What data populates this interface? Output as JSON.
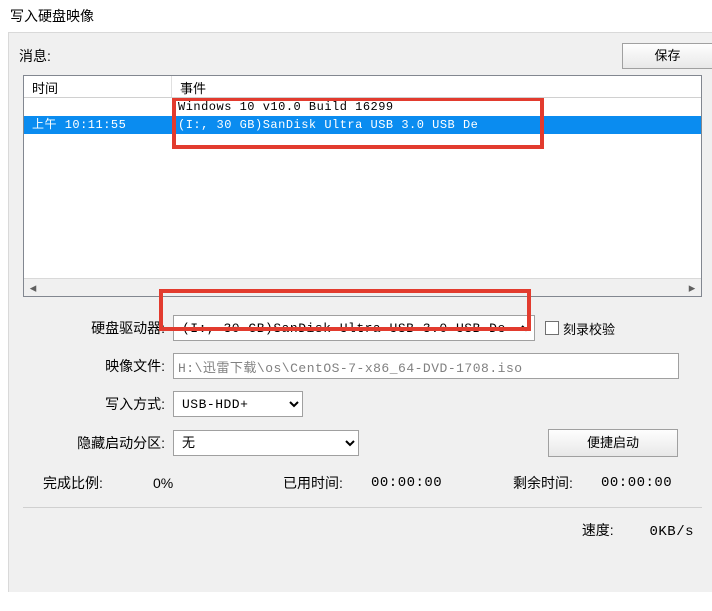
{
  "title": "写入硬盘映像",
  "msgLabel": "消息:",
  "saveLabel": "保存",
  "columns": {
    "time": "时间",
    "event": "事件"
  },
  "rows": [
    {
      "time": "",
      "event": "Windows 10 v10.0 Build 16299"
    },
    {
      "time": "上午 10:11:55",
      "event": "(I:, 30 GB)SanDisk Ultra USB 3.0 USB De"
    }
  ],
  "form": {
    "driveLabel": "硬盘驱动器:",
    "driveValue": "(I:, 30 GB)SanDisk Ultra USB 3.0 USB De",
    "verifyLabel": "刻录校验",
    "imageLabel": "映像文件:",
    "imageValue": "H:\\迅雷下载\\os\\CentOS-7-x86_64-DVD-1708.iso",
    "methodLabel": "写入方式:",
    "methodValue": "USB-HDD+",
    "hiddenLabel": "隐藏启动分区:",
    "hiddenValue": "无",
    "quickBootLabel": "便捷启动"
  },
  "status": {
    "doneLabel": "完成比例:",
    "doneValue": "0%",
    "elapsedLabel": "已用时间:",
    "elapsedValue": "00:00:00",
    "remainLabel": "剩余时间:",
    "remainValue": "00:00:00",
    "speedLabel": "速度:",
    "speedValue": "0KB/s"
  }
}
